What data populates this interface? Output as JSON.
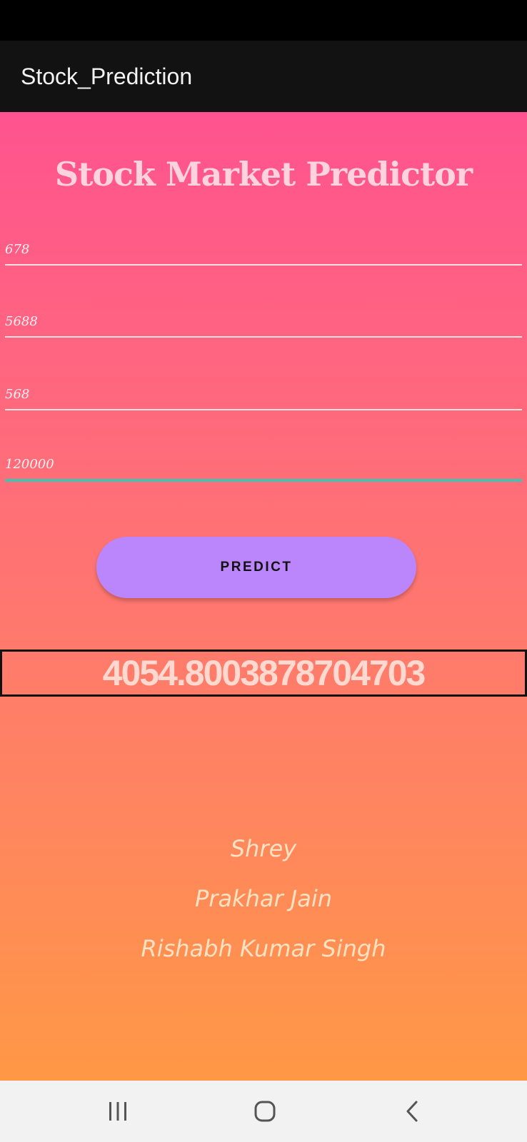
{
  "app_bar": {
    "title": "Stock_Prediction"
  },
  "main": {
    "headline": "Stock Market Predictor",
    "inputs": [
      {
        "value": "678"
      },
      {
        "value": "5688"
      },
      {
        "value": "568"
      },
      {
        "value": "120000"
      }
    ],
    "predict_label": "PREDICT",
    "result": "4054.8003878704703",
    "authors": [
      "Shrey",
      "Prakhar Jain",
      "Rishabh Kumar Singh"
    ]
  },
  "nav_bar": {
    "items": [
      {
        "icon": "recent-apps-icon"
      },
      {
        "icon": "home-icon"
      },
      {
        "icon": "back-icon"
      }
    ]
  },
  "colors": {
    "app_bar": "#121212",
    "gradient_top": "#ff538f",
    "gradient_bottom": "#ff9845",
    "button": "#bb86fc",
    "focus_underline": "#43c2b4"
  }
}
